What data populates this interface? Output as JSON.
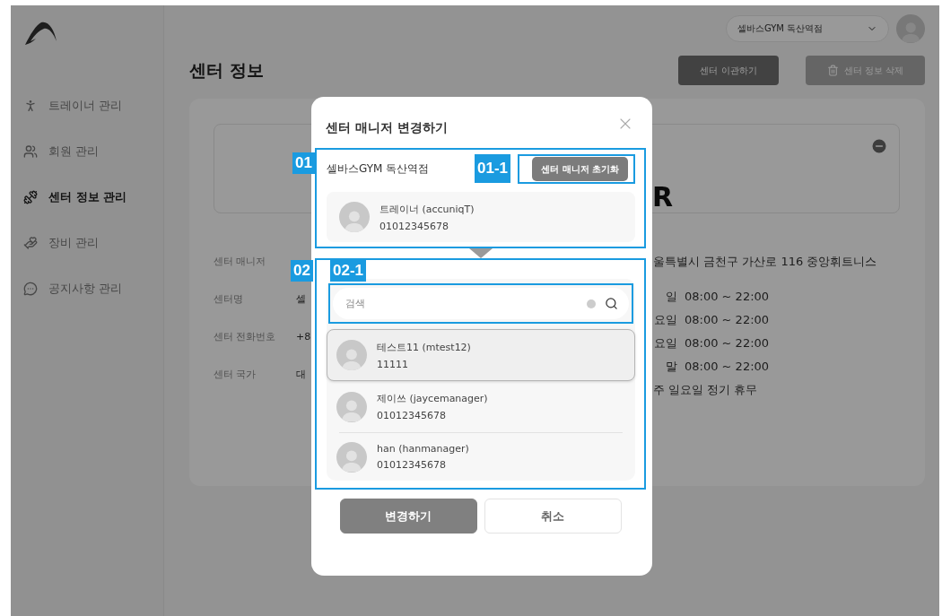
{
  "sidebar": {
    "items": [
      {
        "label": "트레이너 관리",
        "selected": false
      },
      {
        "label": "회원 관리",
        "selected": false
      },
      {
        "label": "센터 정보 관리",
        "selected": true
      },
      {
        "label": "장비 관리",
        "selected": false
      },
      {
        "label": "공지사항 관리",
        "selected": false
      }
    ]
  },
  "topbar": {
    "center_select": "셀바스GYM 독산역점"
  },
  "page": {
    "title": "센터 정보",
    "buttons": [
      {
        "label": "센터 이관하기",
        "disabled": false
      },
      {
        "label": "센터 정보 삭제",
        "disabled": true
      }
    ],
    "card": {
      "banner_text": "R",
      "fields": [
        {
          "label": "센터 매니저"
        },
        {
          "label": "센터명",
          "value": "셀"
        },
        {
          "label": "센터 전화번호",
          "value": "+8"
        },
        {
          "label": "센터 국가",
          "value": "대"
        }
      ],
      "address": "울특별시 금천구 가산로 116 중앙휘트니스",
      "hours": [
        {
          "day": "일",
          "time": "08:00 ~ 22:00"
        },
        {
          "day": "요일",
          "time": "08:00 ~ 22:00"
        },
        {
          "day": "요일",
          "time": "08:00 ~ 22:00"
        },
        {
          "day": "말",
          "time": "08:00 ~ 22:00"
        }
      ],
      "holiday": "주 일요일 정기 휴무"
    }
  },
  "modal": {
    "title": "센터 매니저 변경하기",
    "current": {
      "marker": "01",
      "center_name": "셀바스GYM 독산역점",
      "reset_button": {
        "label": "센터 매니저 초기화",
        "marker": "01-1"
      },
      "manager": {
        "name": "트레이너 (accuniqT)",
        "phone": "01012345678"
      }
    },
    "candidates": {
      "marker": "02",
      "search": {
        "placeholder": "검색",
        "marker": "02-1"
      },
      "items": [
        {
          "name": "테스트11 (mtest12)",
          "phone": "11111",
          "selected": true
        },
        {
          "name": "제이쓰 (jaycemanager)",
          "phone": "01012345678",
          "selected": false
        },
        {
          "name": "han (hanmanager)",
          "phone": "01012345678",
          "selected": false
        }
      ]
    },
    "buttons": [
      {
        "label": "변경하기",
        "kind": "primary"
      },
      {
        "label": "취소",
        "kind": "secondary"
      }
    ]
  }
}
